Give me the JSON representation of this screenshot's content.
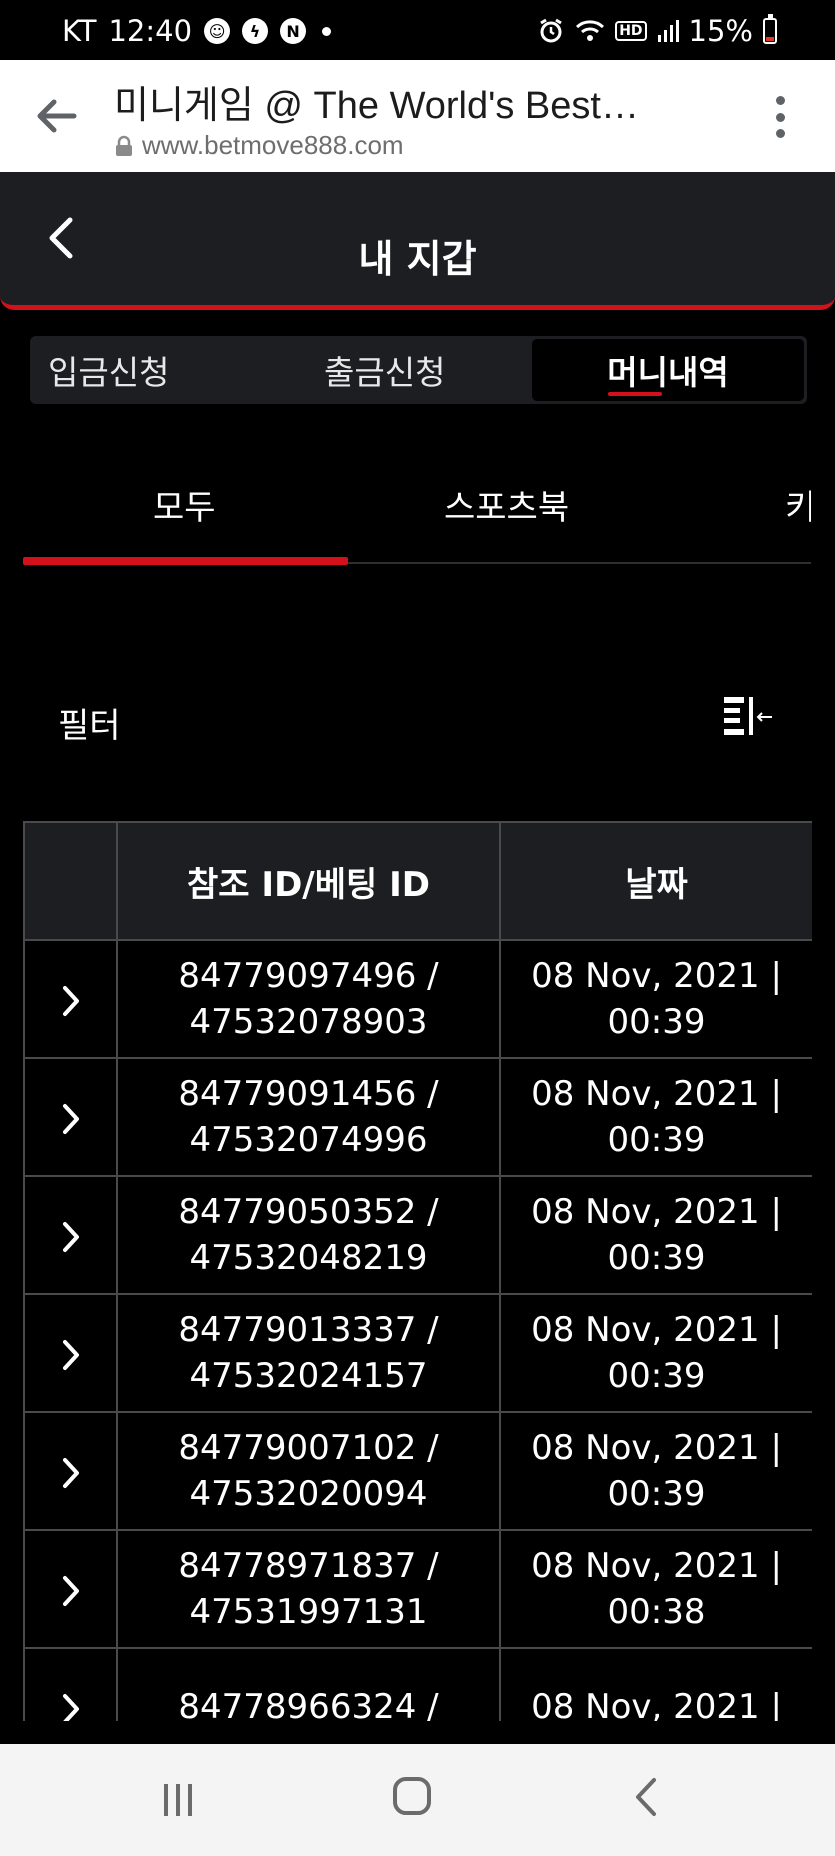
{
  "status_bar": {
    "carrier": "KT",
    "time": "12:40",
    "notif_icons": [
      "mask-app-icon",
      "messenger-icon",
      "n-app-icon"
    ],
    "hd_label": "HD",
    "battery": "15%",
    "battery_level": 0.15
  },
  "browser": {
    "page_title": "미니게임 @ The World's Best…",
    "url": "www.betmove888.com"
  },
  "header": {
    "title": "내 지갑"
  },
  "segments": [
    {
      "label": "입금신청",
      "active": false
    },
    {
      "label": "출금신청",
      "active": false
    },
    {
      "label": "머니내역",
      "active": true
    }
  ],
  "subtabs": [
    {
      "label": "모두",
      "active": true
    },
    {
      "label": "스포츠북",
      "active": false
    },
    {
      "label": "키",
      "active": false
    }
  ],
  "filter": {
    "label": "필터"
  },
  "table": {
    "headers": [
      "",
      "참조 ID/베팅 ID",
      "날짜"
    ],
    "rows": [
      {
        "ref_id": "84779097496 /",
        "bet_id": "47532078903",
        "date": "08 Nov, 2021 |",
        "time": "00:39"
      },
      {
        "ref_id": "84779091456 /",
        "bet_id": "47532074996",
        "date": "08 Nov, 2021 |",
        "time": "00:39"
      },
      {
        "ref_id": "84779050352 /",
        "bet_id": "47532048219",
        "date": "08 Nov, 2021 |",
        "time": "00:39"
      },
      {
        "ref_id": "84779013337 /",
        "bet_id": "47532024157",
        "date": "08 Nov, 2021 |",
        "time": "00:39"
      },
      {
        "ref_id": "84779007102 /",
        "bet_id": "47532020094",
        "date": "08 Nov, 2021 |",
        "time": "00:39"
      },
      {
        "ref_id": "84778971837 /",
        "bet_id": "47531997131",
        "date": "08 Nov, 2021 |",
        "time": "00:38"
      },
      {
        "ref_id": "84778966324 /",
        "bet_id": "",
        "date": "08 Nov, 2021 |",
        "time": ""
      }
    ]
  },
  "colors": {
    "accent": "#d4101a",
    "header_bg": "#1d1e22",
    "background": "#000000",
    "border": "#4a4a4a"
  }
}
